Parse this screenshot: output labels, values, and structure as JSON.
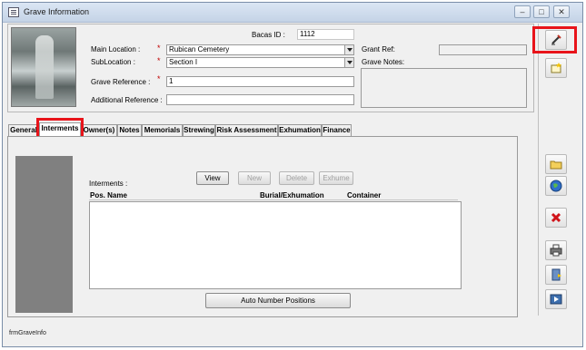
{
  "window": {
    "title": "Grave Information",
    "controls": [
      "–",
      "□",
      "✕"
    ]
  },
  "header": {
    "bacas_id_label": "Bacas ID :",
    "bacas_id_value": "1112",
    "main_location_label": "Main Location :",
    "main_location_value": "Rubican Cemetery",
    "sublocation_label": "SubLocation :",
    "sublocation_value": "Section I",
    "grave_reference_label": "Grave Reference :",
    "grave_reference_value": "1",
    "additional_reference_label": "Additional Reference :",
    "additional_reference_value": "",
    "grant_ref_label": "Grant Ref:",
    "grant_ref_value": "",
    "grave_notes_label": "Grave Notes:",
    "grave_notes_value": "",
    "required_marker": "*"
  },
  "tabs": [
    {
      "label": "General",
      "active": false
    },
    {
      "label": "Interments",
      "active": true
    },
    {
      "label": "Owner(s)",
      "active": false
    },
    {
      "label": "Notes",
      "active": false
    },
    {
      "label": "Memorials",
      "active": false
    },
    {
      "label": "Strewing",
      "active": false
    },
    {
      "label": "Risk Assessment",
      "active": false
    },
    {
      "label": "Exhumation",
      "active": false
    },
    {
      "label": "Finance",
      "active": false
    }
  ],
  "interments": {
    "section_label": "Interments :",
    "buttons": {
      "view": "View",
      "new": "New",
      "delete": "Delete",
      "exhume": "Exhume"
    },
    "columns": [
      "Pos. Name",
      "Burial/Exhumation",
      "Container"
    ],
    "rows": [],
    "auto_number_button": "Auto Number Positions"
  },
  "sidebar": {
    "icons": [
      "pencil-icon",
      "new-record-icon",
      "folder-icon",
      "globe-icon",
      "delete-icon",
      "print-icon",
      "exit-icon",
      "next-icon"
    ]
  },
  "status_bar": {
    "form_name": "frmGraveInfo"
  },
  "colors": {
    "highlight": "#e8141a",
    "required": "#c00000"
  }
}
